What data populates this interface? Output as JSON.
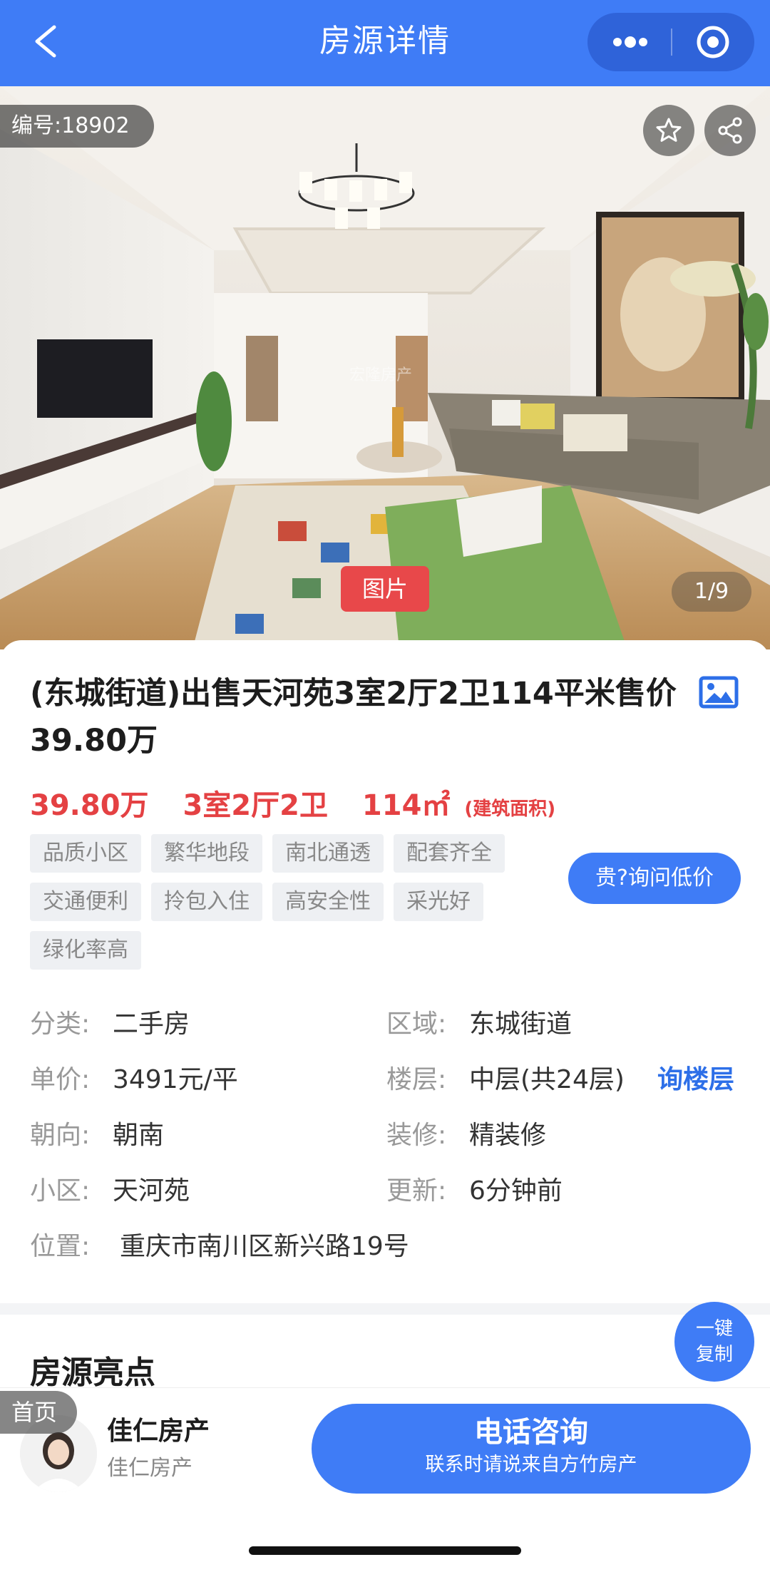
{
  "header": {
    "title": "房源详情",
    "back_icon": "chevron-left-icon",
    "menu_icon": "more-dots-icon",
    "close_icon": "target-circle-icon",
    "bg_color": "#3f7cf6"
  },
  "gallery": {
    "listing_id": "编号:18902",
    "tag": "图片",
    "counter": "1/9",
    "watermark": "宏隆房产",
    "favorite_icon": "star-icon",
    "share_icon": "share-icon"
  },
  "listing": {
    "title": "(东城街道)出售天河苑3室2厅2卫114平米售价39.80万",
    "price": "39.80万",
    "layout": "3室2厅2卫",
    "area": "114㎡",
    "area_note": "(建筑面积)",
    "tags": [
      "品质小区",
      "繁华地段",
      "南北通透",
      "配套齐全",
      "交通便利",
      "拎包入住",
      "高安全性",
      "采光好",
      "绿化率高"
    ],
    "ask_low_price": "贵?询问低价",
    "accent_color": "#e44143"
  },
  "properties": {
    "category_label": "分类:",
    "category": "二手房",
    "district_label": "区域:",
    "district": "东城街道",
    "unit_price_label": "单价:",
    "unit_price": "3491元/平",
    "floor_label": "楼层:",
    "floor": "中层(共24层)",
    "ask_floor": "询楼层",
    "orientation_label": "朝向:",
    "orientation": "朝南",
    "decoration_label": "装修:",
    "decoration": "精装修",
    "community_label": "小区:",
    "community": "天河苑",
    "updated_label": "更新:",
    "updated": "6分钟前",
    "location_label": "位置:",
    "location": "重庆市南川区新兴路19号"
  },
  "highlights": {
    "title": "房源亮点",
    "copy_line1": "一键",
    "copy_line2": "复制"
  },
  "bottom": {
    "home": "首页",
    "agent_name": "佳仁房产",
    "agent_company": "佳仁房产",
    "call_label": "电话咨询",
    "call_note": "联系时请说来自方竹房产"
  }
}
